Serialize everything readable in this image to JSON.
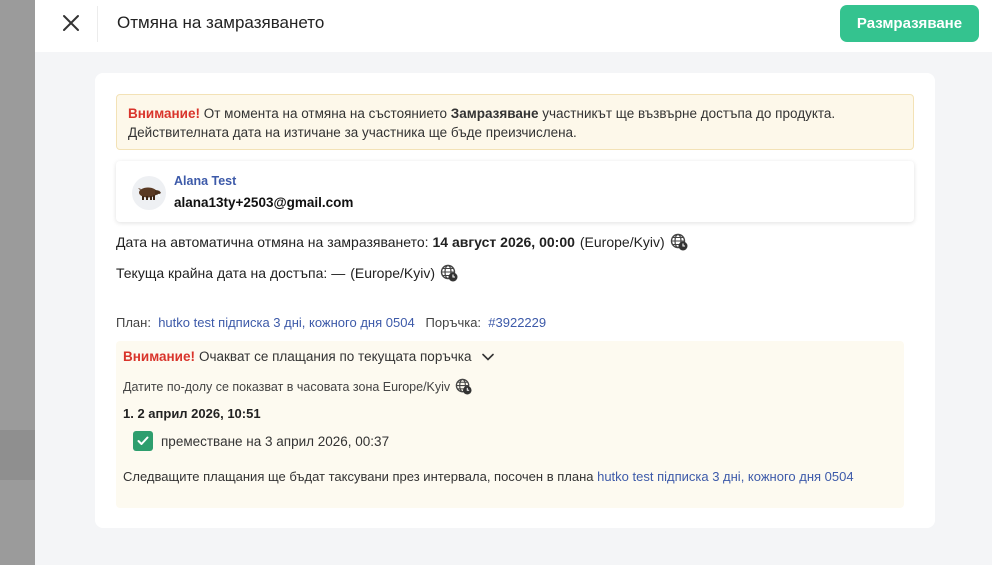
{
  "header": {
    "title": "Отмяна на замразяването",
    "unfreeze_label": "Размразяване"
  },
  "warning": {
    "strong": "Внимание!",
    "text_before": " От момента на отмяна на състоянието ",
    "bold": "Замразяване",
    "text_after": " участникът ще възвърне достъпа до продукта. Действителната дата на изтичане за участника ще бъде преизчислена."
  },
  "user": {
    "name": "Alana Test",
    "email": "alana13ty+2503@gmail.com"
  },
  "auto_cancel": {
    "label": "Дата на автоматична отмяна на замразяването:",
    "value": "14 август 2026, 00:00",
    "timezone": "(Europe/Kyiv)"
  },
  "current_end": {
    "label": "Текуща крайна дата на достъпа: —",
    "timezone": "(Europe/Kyiv)"
  },
  "plan": {
    "label": "План:",
    "value": "hutko test підписка 3 дні, кожного дня 0504",
    "order_label": "Поръчка:",
    "order_value": "#3922229"
  },
  "pending": {
    "strong": "Внимание!",
    "title": "Очакват се плащания по текущата поръчка",
    "tz_note": "Датите по-долу се показват в часовата зона Europe/Kyiv",
    "item": "1. 2 април 2026, 10:51",
    "checkbox_label": "преместване на 3 април 2026, 00:37",
    "footer_text": "Следващите плащания ще бъдат таксувани през интервала, посочен в плана ",
    "footer_link": "hutko test підписка 3 дні, кожного дня 0504"
  },
  "colors": {
    "accent": "#34c38f",
    "warning_text": "#d9342b",
    "link": "#3d5aa9",
    "checkbox": "#2e9e6e"
  },
  "icons": {
    "close": "close-icon",
    "globe": "globe-clock-icon",
    "chevron": "chevron-down-icon",
    "check": "check-icon"
  }
}
